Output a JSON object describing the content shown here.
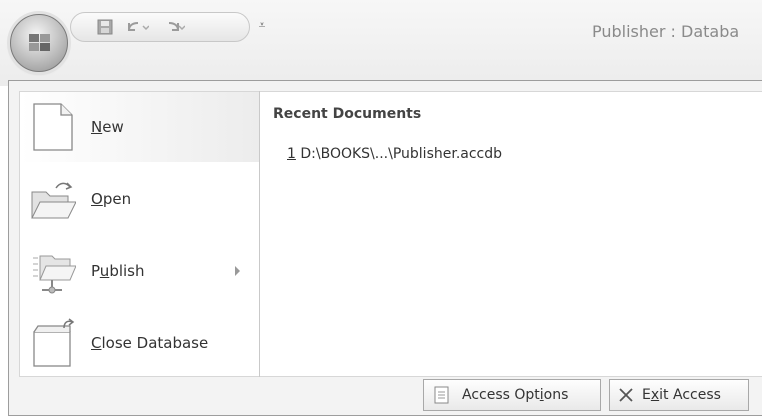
{
  "window": {
    "title": "Publisher : Databa"
  },
  "quick_access": {
    "icons": [
      "save-icon",
      "undo-icon",
      "redo-icon"
    ],
    "more_glyph": "⩡"
  },
  "menu": {
    "items": [
      {
        "label_prefix": "",
        "label_mnemonic": "N",
        "label_suffix": "ew",
        "icon": "new-document-icon",
        "active": true
      },
      {
        "label_prefix": "",
        "label_mnemonic": "O",
        "label_suffix": "pen",
        "icon": "open-folder-icon"
      },
      {
        "label_prefix": "P",
        "label_mnemonic": "u",
        "label_suffix": "blish",
        "icon": "publish-icon",
        "has_submenu": true
      },
      {
        "label_prefix": "",
        "label_mnemonic": "C",
        "label_suffix": "lose Database",
        "icon": "close-database-icon"
      }
    ]
  },
  "recent": {
    "title": "Recent Documents",
    "items": [
      {
        "index": "1",
        "path": " D:\\BOOKS\\...\\Publisher.accdb"
      }
    ]
  },
  "footer": {
    "options": {
      "prefix": "Access Opt",
      "mnemonic": "i",
      "suffix": "ons",
      "icon": "options-icon"
    },
    "exit": {
      "prefix": "E",
      "mnemonic": "x",
      "suffix": "it Access",
      "icon": "close-x-icon"
    }
  },
  "colors": {
    "panel": "#f3f3f3",
    "pane": "#ffffff",
    "border": "#9d9d9d"
  }
}
